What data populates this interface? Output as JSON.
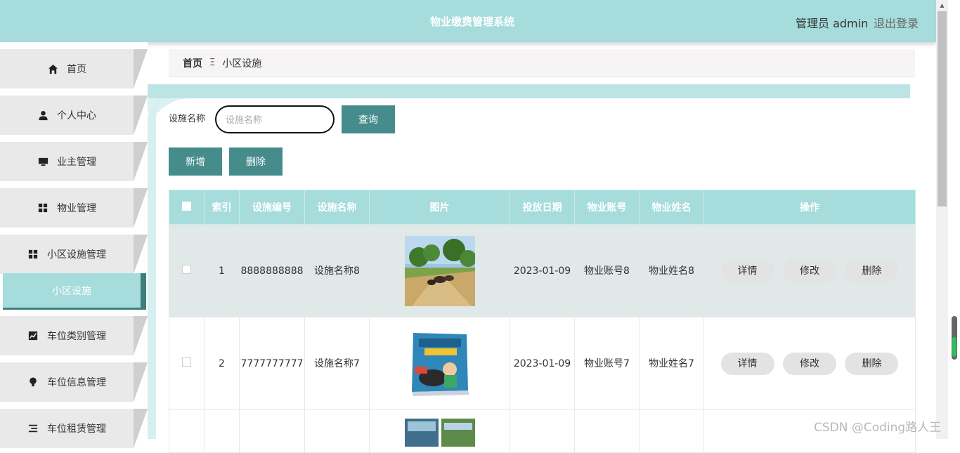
{
  "header": {
    "title": "物业缴费管理系统",
    "user": "管理员 admin",
    "logout": "退出登录"
  },
  "sidebar": {
    "items": [
      {
        "label": "首页",
        "icon": "home-icon"
      },
      {
        "label": "个人中心",
        "icon": "user-icon"
      },
      {
        "label": "业主管理",
        "icon": "monitor-icon"
      },
      {
        "label": "物业管理",
        "icon": "grid-icon"
      },
      {
        "label": "小区设施管理",
        "icon": "grid-icon"
      },
      {
        "label": "车位类别管理",
        "icon": "chart-icon"
      },
      {
        "label": "车位信息管理",
        "icon": "lightbulb-icon"
      },
      {
        "label": "车位租赁管理",
        "icon": "list-icon"
      }
    ],
    "active_sub": "小区设施"
  },
  "breadcrumb": {
    "home": "首页",
    "separator": "Ξ",
    "current": "小区设施"
  },
  "search": {
    "label": "设施名称",
    "placeholder": "设施名称",
    "button": "查询"
  },
  "actions": {
    "add": "新增",
    "delete": "删除"
  },
  "table": {
    "headers": [
      "索引",
      "设施编号",
      "设施名称",
      "图片",
      "投放日期",
      "物业账号",
      "物业姓名",
      "操作"
    ],
    "rows": [
      {
        "index": "1",
        "code": "8888888888",
        "name": "设施名称8",
        "image": "farm-photo",
        "date": "2023-01-09",
        "account": "物业账号8",
        "owner": "物业姓名8"
      },
      {
        "index": "2",
        "code": "7777777777",
        "name": "设施名称7",
        "image": "zoo-book-cover",
        "date": "2023-01-09",
        "account": "物业账号7",
        "owner": "物业姓名7"
      }
    ],
    "row_actions": {
      "detail": "详情",
      "edit": "修改",
      "delete": "删除"
    }
  },
  "watermark": "CSDN @Coding路人王",
  "colors": {
    "header": "#a6dcdc",
    "button": "#468c8c",
    "sidebar_item": "#e9e9e9",
    "row_highlight": "#e1e8e8"
  }
}
